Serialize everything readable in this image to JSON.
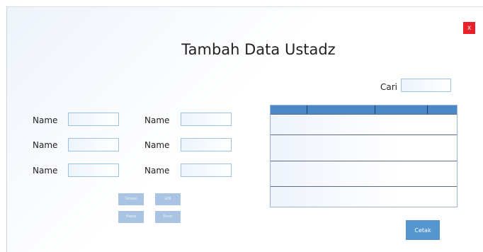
{
  "window": {
    "title": "Tambah Data Ustadz",
    "close_label": "x"
  },
  "search": {
    "label": "Cari",
    "value": ""
  },
  "form": {
    "left_fields": [
      {
        "label": "Name",
        "value": ""
      },
      {
        "label": "Name",
        "value": ""
      },
      {
        "label": "Name",
        "value": ""
      }
    ],
    "right_fields": [
      {
        "label": "Name",
        "value": ""
      },
      {
        "label": "Name",
        "value": ""
      },
      {
        "label": "Name",
        "value": ""
      }
    ]
  },
  "actions": {
    "simpan": "Simpan",
    "edit": "Edit",
    "hapus": "Hapus",
    "reset": "Reset"
  },
  "table": {
    "columns": [
      "",
      "",
      "",
      ""
    ],
    "rows": [
      "",
      "",
      "",
      ""
    ]
  },
  "print_button": "Cetak",
  "colors": {
    "accent": "#4a88c8",
    "close": "#e8202a",
    "field_border": "#9cc3e6",
    "button_disabled": "#a9c4e3"
  }
}
